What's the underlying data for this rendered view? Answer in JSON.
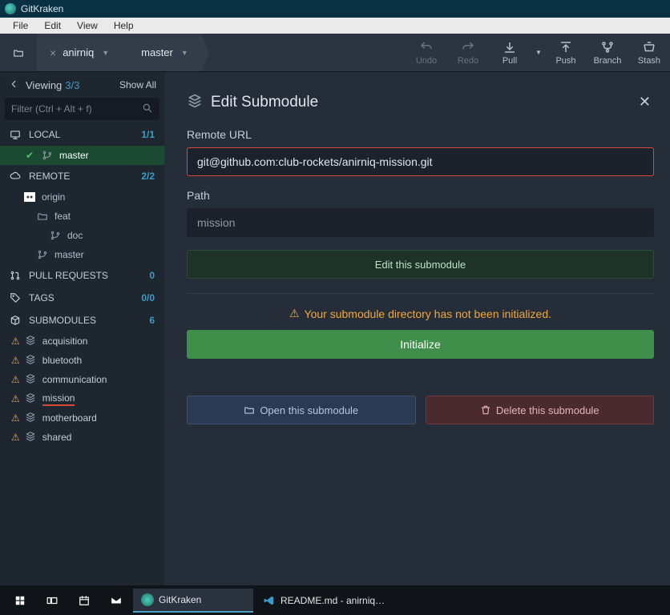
{
  "titlebar": {
    "app_name": "GitKraken"
  },
  "menubar": {
    "items": [
      "File",
      "Edit",
      "View",
      "Help"
    ]
  },
  "toolbar": {
    "repo": "anirniq",
    "branch": "master",
    "buttons": {
      "undo": "Undo",
      "redo": "Redo",
      "pull": "Pull",
      "push": "Push",
      "branch": "Branch",
      "stash": "Stash"
    }
  },
  "sidebar": {
    "viewing_label": "Viewing",
    "viewing_count": "3/3",
    "showall": "Show All",
    "filter_placeholder": "Filter (Ctrl + Alt + f)",
    "local": {
      "label": "LOCAL",
      "count": "1/1",
      "items": [
        {
          "name": "master",
          "active": true
        }
      ]
    },
    "remote": {
      "label": "REMOTE",
      "count": "2/2",
      "origin_label": "origin",
      "items": [
        "feat",
        "doc",
        "master"
      ]
    },
    "pull_requests": {
      "label": "PULL REQUESTS",
      "count": "0"
    },
    "tags": {
      "label": "TAGS",
      "count": "0/0"
    },
    "submodules": {
      "label": "SUBMODULES",
      "count": "6",
      "items": [
        {
          "name": "acquisition"
        },
        {
          "name": "bluetooth"
        },
        {
          "name": "communication"
        },
        {
          "name": "mission",
          "selected": true
        },
        {
          "name": "motherboard"
        },
        {
          "name": "shared"
        }
      ]
    }
  },
  "panel": {
    "title": "Edit Submodule",
    "remote_url_label": "Remote URL",
    "remote_url_value": "git@github.com:club-rockets/anirniq-mission.git",
    "path_label": "Path",
    "path_value": "mission",
    "edit_button": "Edit this submodule",
    "warning": "Your submodule directory has not been initialized.",
    "initialize_button": "Initialize",
    "open_button": "Open this submodule",
    "delete_button": "Delete this submodule"
  },
  "taskbar": {
    "gitkraken": "GitKraken",
    "readme": "README.md - anirniq…"
  }
}
